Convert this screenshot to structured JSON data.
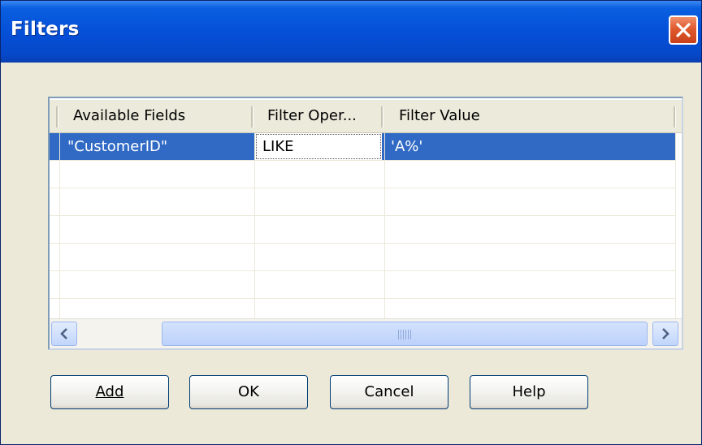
{
  "window": {
    "title": "Filters",
    "close_icon": "close-icon"
  },
  "grid": {
    "columns": [
      "Available Fields",
      "Filter Oper...",
      "Filter Value"
    ],
    "rows": [
      {
        "field": "\"CustomerID\"",
        "operator": "LIKE",
        "value": "'A%'",
        "selected": true
      }
    ],
    "empty_row_count": 6
  },
  "scrollbar": {
    "left_icon": "chevron-left-icon",
    "right_icon": "chevron-right-icon"
  },
  "buttons": {
    "add": "Add",
    "ok": "OK",
    "cancel": "Cancel",
    "help": "Help"
  },
  "colors": {
    "titlebar": "#0550d8",
    "selection": "#316ac5",
    "dialog_bg": "#ece9d8",
    "close_button": "#e05a2e"
  }
}
